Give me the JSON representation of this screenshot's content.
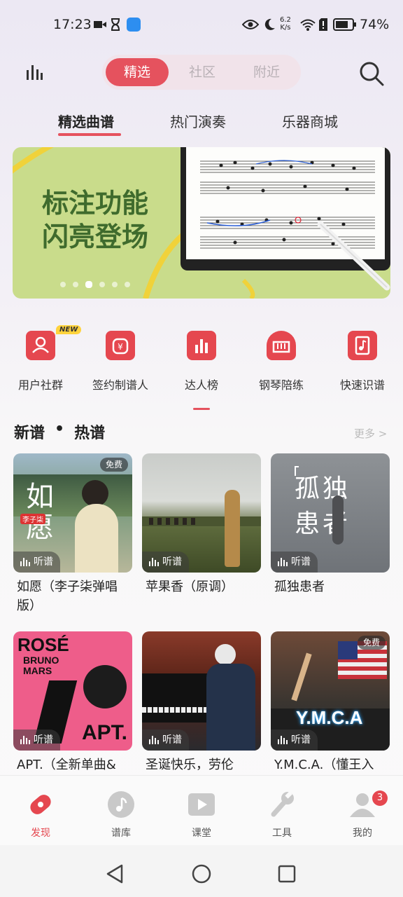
{
  "status_bar": {
    "time": "17:23",
    "net_speed": "6.2\nK/s",
    "net_top": "6.2",
    "net_bottom": "K/s",
    "battery": "74%"
  },
  "top": {
    "segments": [
      "精选",
      "社区",
      "附近"
    ],
    "active_segment": 0
  },
  "subtabs": [
    "精选曲谱",
    "热门演奏",
    "乐器商城"
  ],
  "banner": {
    "line1": "标注功能",
    "line2": "闪亮登场",
    "active_dot": 2,
    "dots": 6
  },
  "entries": [
    {
      "label": "用户社群",
      "icon": "user-group-icon",
      "badge": "NEW"
    },
    {
      "label": "签约制谱人",
      "icon": "contract-icon"
    },
    {
      "label": "达人榜",
      "icon": "ranking-icon"
    },
    {
      "label": "钢琴陪练",
      "icon": "piano-icon"
    },
    {
      "label": "快速识谱",
      "icon": "music-book-icon"
    }
  ],
  "section": {
    "title_a": "新谱",
    "title_sep": "•",
    "title_b": "热谱",
    "more": "更多 >"
  },
  "cards": [
    {
      "title": "如愿（李子柒弹唱版）",
      "pill": "听谱",
      "free": "免费",
      "cover_text": "如愿",
      "cover_tag": "李子柒"
    },
    {
      "title": "苹果香（原调）",
      "pill": "听谱"
    },
    {
      "title": "孤独患者",
      "pill": "听谱",
      "cover_text1": "孤独",
      "cover_text2": "患者"
    },
    {
      "title": "APT.（全新单曲&",
      "pill": "听谱",
      "cover_rose": "ROSÉ",
      "cover_bruno": "BRUNO",
      "cover_mars": "MARS",
      "cover_apt": "APT."
    },
    {
      "title": "圣诞快乐，劳伦",
      "pill": "听谱"
    },
    {
      "title": "Y.M.C.A.（懂王入",
      "pill": "听谱",
      "free": "免费",
      "cover_text": "Y.M.C.A"
    }
  ],
  "tabbar": [
    {
      "label": "发现",
      "icon": "discover-icon",
      "active": true
    },
    {
      "label": "谱库",
      "icon": "music-note-icon"
    },
    {
      "label": "课堂",
      "icon": "video-play-icon"
    },
    {
      "label": "工具",
      "icon": "wrench-icon"
    },
    {
      "label": "我的",
      "icon": "profile-icon",
      "badge": "3"
    }
  ],
  "colors": {
    "accent": "#e5525e",
    "banner_green": "#c9dc8b",
    "banner_text": "#3f6b2d"
  }
}
